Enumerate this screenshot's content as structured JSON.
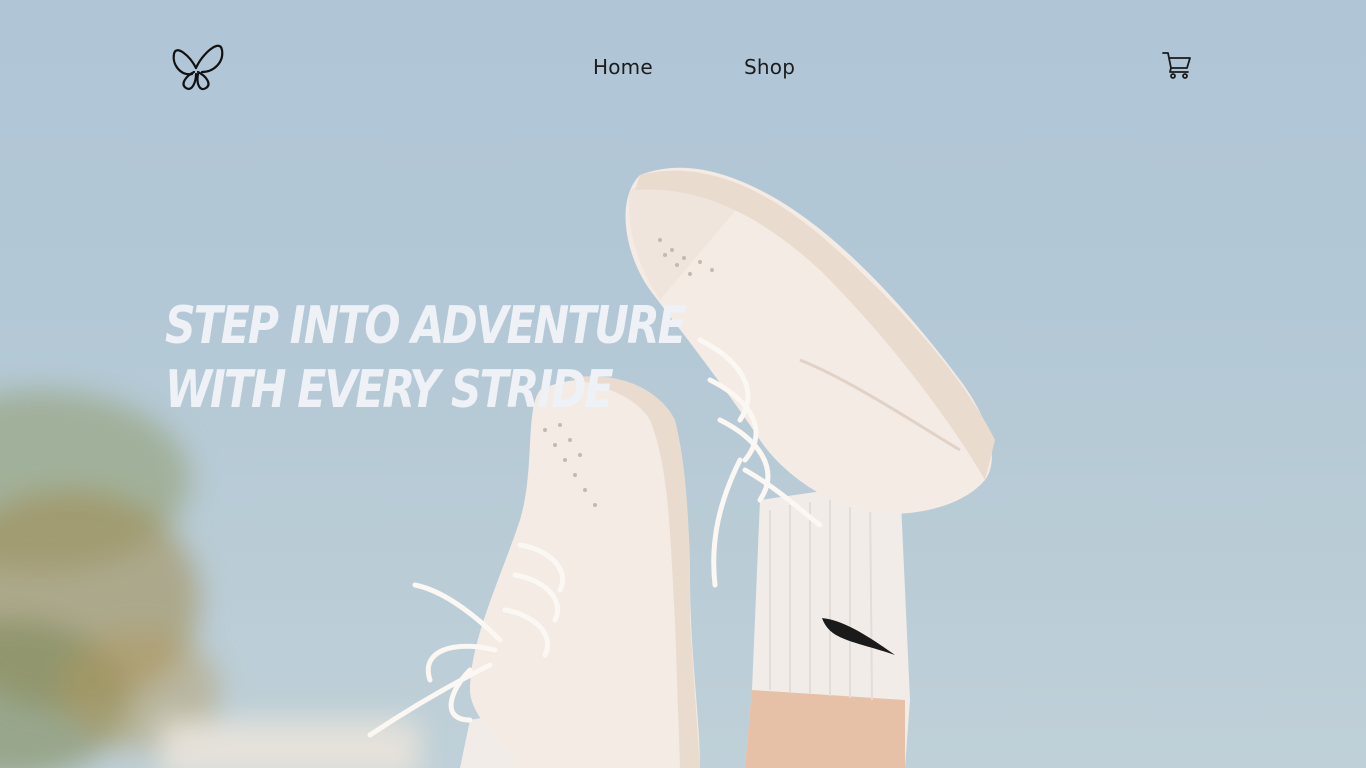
{
  "nav": {
    "logo_icon": "butterfly-logo-icon",
    "links": [
      {
        "label": "Home"
      },
      {
        "label": "Shop"
      }
    ],
    "cart_icon": "shopping-cart-icon"
  },
  "hero": {
    "headline": "Step into adventure with every stride",
    "image_description_icon": "sneakers-in-air-image",
    "colors": {
      "sky": "#b0c5d6",
      "headline": "#eef1f5",
      "nav_text": "#1c1c1c"
    }
  }
}
